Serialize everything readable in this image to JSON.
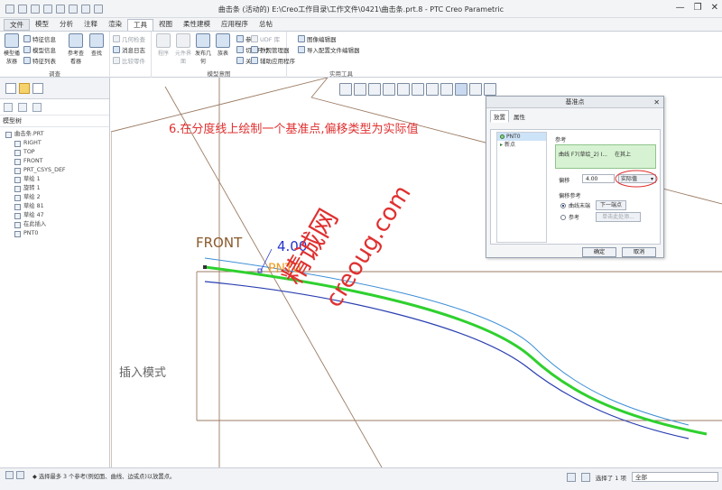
{
  "window": {
    "title": "曲击条 (活动的) E:\\Creo工作目录\\工作文件\\0421\\曲击条.prt.8 - PTC Creo Parametric",
    "controls": [
      "—",
      "❐",
      "✕"
    ]
  },
  "menu_tabs": [
    "文件",
    "模型",
    "分析",
    "注释",
    "渲染",
    "工具",
    "视图",
    "柔性建模",
    "应用程序",
    "总帖"
  ],
  "active_tab": "工具",
  "ribbon": {
    "groups": {
      "investigate": "调查",
      "model_intent": "模型意图",
      "utilities": "实用工具"
    },
    "investigate_items": {
      "model_player": "模型播放器",
      "feature_info": "特征信息",
      "model_info": "模型信息",
      "feature_list": "特征列表",
      "reference_viewer": "参考查看器",
      "find": "查找",
      "geometry_check": "几何检查",
      "message_log": "消息日志",
      "compare_parts": "比较零件"
    },
    "intent_items": {
      "program": "程序",
      "comp_interface": "元件界面",
      "publish_geom": "发布几何",
      "family_table": "族表",
      "parameters": "参数",
      "switch_dims": "切换尺寸",
      "relations": "关系"
    },
    "utility_items": {
      "udf_library": "UDF 库",
      "image_editor": "图像编辑器",
      "external_manager": "外观管理器",
      "import_config": "导入配置文件编辑器",
      "aux_apps": "辅助应用程序"
    }
  },
  "model_tree": {
    "header": "模型树",
    "items": [
      {
        "label": "曲击条.PRT",
        "sub": false,
        "icon": "part-icon"
      },
      {
        "label": "RIGHT",
        "sub": true,
        "icon": "datum-plane-icon"
      },
      {
        "label": "TOP",
        "sub": true,
        "icon": "datum-plane-icon"
      },
      {
        "label": "FRONT",
        "sub": true,
        "icon": "datum-plane-icon"
      },
      {
        "label": "PRT_CSYS_DEF",
        "sub": true,
        "icon": "csys-icon"
      },
      {
        "label": "草绘 1",
        "sub": true,
        "icon": "sketch-icon"
      },
      {
        "label": "旋转 1",
        "sub": true,
        "icon": "revolve-icon"
      },
      {
        "label": "草绘 2",
        "sub": true,
        "icon": "sketch-icon"
      },
      {
        "label": "草绘 81",
        "sub": true,
        "icon": "sketch-icon"
      },
      {
        "label": "草绘 47",
        "sub": true,
        "icon": "sketch-icon"
      },
      {
        "label": "在此插入",
        "sub": true,
        "icon": "insert-arrow-icon"
      },
      {
        "label": "PNT0",
        "sub": true,
        "icon": "datum-point-icon"
      }
    ]
  },
  "canvas": {
    "instruction": "6.在分度线上绘制一个基准点,偏移类型为实际值",
    "front_label": "FRONT",
    "dimension": "4.00",
    "point_label": "PNT0",
    "mode_text": "插入模式",
    "watermark_cn": "精诚网",
    "watermark_url": "creoug.com"
  },
  "dialog": {
    "title": "基准点",
    "tabs": [
      "放置",
      "属性"
    ],
    "points": [
      "PNT0",
      "新点"
    ],
    "reference_label": "参考",
    "reference_value": "曲线 F7(草绘_2) I...",
    "reference_mode": "在其上",
    "offset_label": "偏移",
    "offset_value": "4.00",
    "offset_type": "实际值",
    "offset_ref_label": "偏移参考",
    "curve_end": "曲线末端",
    "next_end": "下一端点",
    "reference_radio": "参考",
    "click_select": "单击此处添...",
    "ok": "确定",
    "cancel": "取消"
  },
  "status": {
    "message": "◆ 选择最多 3 个参考(例如面、曲线、边或点)以放置点。",
    "selected": "选择了 1 项",
    "filter": "全部"
  }
}
